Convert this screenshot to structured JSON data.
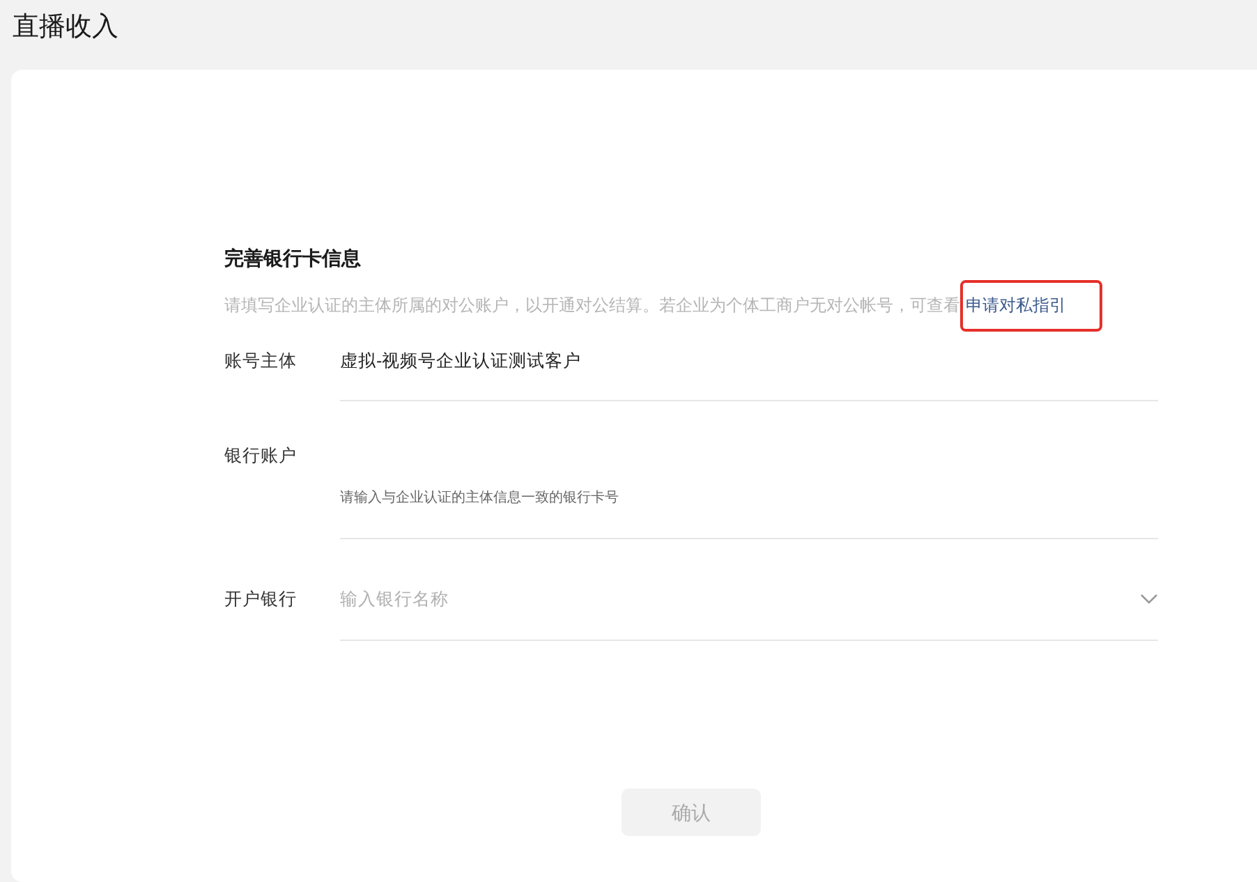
{
  "page_title": "直播收入",
  "form": {
    "heading": "完善银行卡信息",
    "description": "请填写企业认证的主体所属的对公账户，以开通对公结算。若企业为个体工商户无对公帐号，可查看",
    "guide_link": {
      "label": "申请对私指引",
      "highlighted": true
    },
    "fields": [
      {
        "kind": "static",
        "label": "账号主体",
        "value": "虚拟-视频号企业认证测试客户"
      },
      {
        "kind": "input",
        "label": "银行账户",
        "hint": "请输入与企业认证的主体信息一致的银行卡号"
      },
      {
        "kind": "select",
        "label": "开户银行",
        "placeholder": "输入银行名称"
      }
    ],
    "confirm": {
      "label": "确认",
      "disabled": true
    }
  }
}
